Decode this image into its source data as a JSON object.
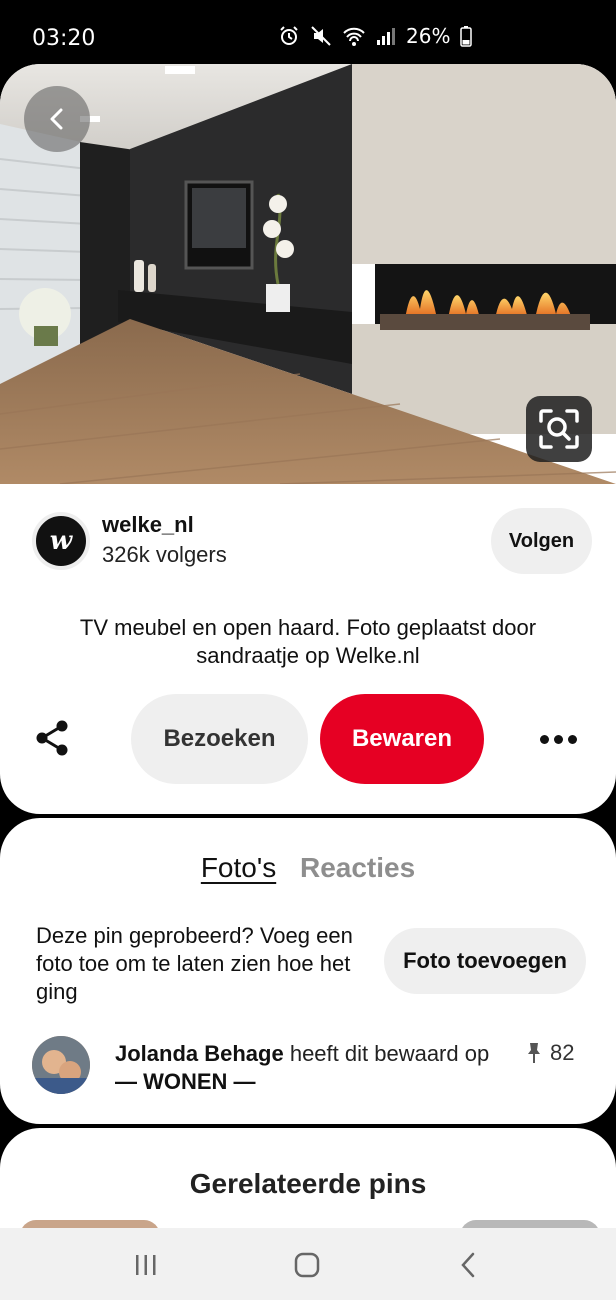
{
  "status_bar": {
    "time": "03:20",
    "battery": "26%",
    "icons": [
      "alarm-icon",
      "mute-icon",
      "wifi-icon",
      "signal-icon",
      "battery-icon"
    ]
  },
  "pin": {
    "image_alt": "Living room with TV furniture and fireplace",
    "creator": {
      "avatar_letter": "w",
      "name": "welke_nl",
      "followers": "326k volgers",
      "follow_label": "Volgen"
    },
    "description": "TV meubel en open haard. Foto geplaatst door sandraatje op Welke.nl",
    "actions": {
      "visit_label": "Bezoeken",
      "save_label": "Bewaren"
    }
  },
  "comments": {
    "tabs": [
      {
        "label": "Foto's",
        "active": true
      },
      {
        "label": "Reacties",
        "active": false
      }
    ],
    "tried_prompt": "Deze pin geprobeerd? Voeg een foto toe om te laten zien hoe het ging",
    "add_photo_label": "Foto toevoegen",
    "activity": {
      "user": "Jolanda Behage",
      "action": " heeft dit bewaard op ",
      "board": "— WONEN —",
      "count": "82"
    }
  },
  "related": {
    "title": "Gerelateerde pins"
  },
  "colors": {
    "accent": "#e60023",
    "button_bg": "#efefef"
  }
}
